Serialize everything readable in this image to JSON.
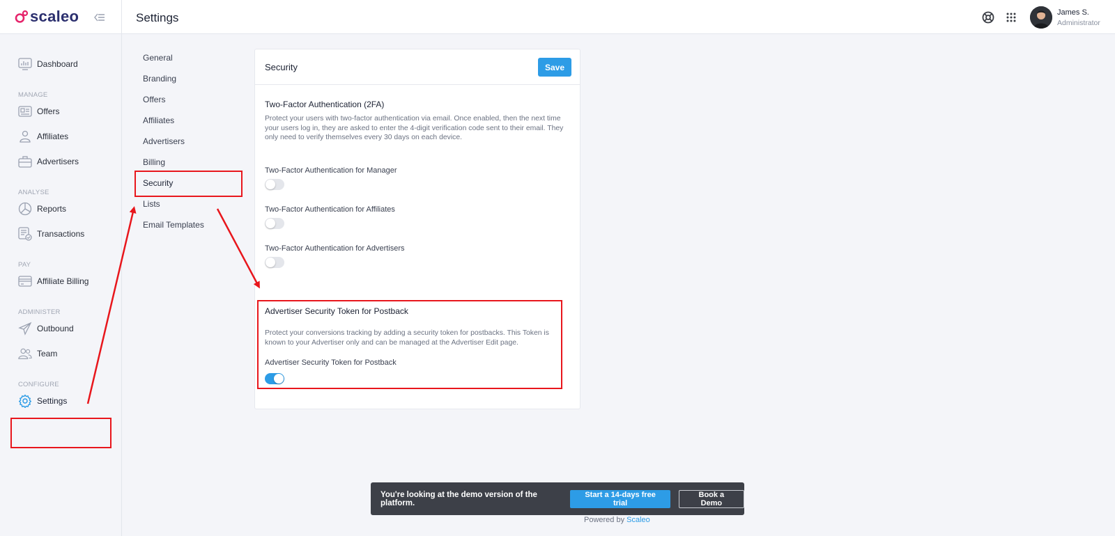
{
  "app": {
    "logo_text": "scaleo",
    "brand_color": "#e5246b",
    "accent": "#2d9ce6"
  },
  "header": {
    "title": "Settings",
    "user": {
      "name": "James S.",
      "role": "Administrator"
    }
  },
  "sidebar": {
    "items": [
      {
        "label": "Dashboard",
        "icon": "dashboard-icon"
      },
      {
        "section": "MANAGE"
      },
      {
        "label": "Offers",
        "icon": "offers-icon"
      },
      {
        "label": "Affiliates",
        "icon": "user-icon"
      },
      {
        "label": "Advertisers",
        "icon": "briefcase-icon"
      },
      {
        "section": "ANALYSE"
      },
      {
        "label": "Reports",
        "icon": "pie-chart-icon"
      },
      {
        "label": "Transactions",
        "icon": "transactions-icon"
      },
      {
        "section": "PAY"
      },
      {
        "label": "Affiliate Billing",
        "icon": "credit-card-icon"
      },
      {
        "section": "ADMINISTER"
      },
      {
        "label": "Outbound",
        "icon": "paper-plane-icon"
      },
      {
        "label": "Team",
        "icon": "team-icon"
      },
      {
        "section": "CONFIGURE"
      },
      {
        "label": "Settings",
        "icon": "gear-icon",
        "active": true
      }
    ]
  },
  "submenu": {
    "items": [
      "General",
      "Branding",
      "Offers",
      "Affiliates",
      "Advertisers",
      "Billing",
      "Security",
      "Lists",
      "Email Templates"
    ],
    "active": "Security"
  },
  "card": {
    "title": "Security",
    "save_label": "Save",
    "twofa": {
      "title": "Two-Factor Authentication (2FA)",
      "description": "Protect your users with two-factor authentication via email. Once enabled, then the next time your users log in, they are asked to enter the 4-digit verification code sent to their email. They only need to verify themselves every 30 days on each device.",
      "toggles": [
        {
          "label": "Two-Factor Authentication for Manager",
          "on": false
        },
        {
          "label": "Two-Factor Authentication for Affiliates",
          "on": false
        },
        {
          "label": "Two-Factor Authentication for Advertisers",
          "on": false
        }
      ]
    },
    "token": {
      "title": "Advertiser Security Token for Postback",
      "description": "Protect your conversions tracking by adding a security token for postbacks. This Token is known to your Advertiser only and can be managed at the Advertiser Edit page.",
      "toggle_label": "Advertiser Security Token for Postback",
      "on": true
    }
  },
  "demo_banner": {
    "text": "You're looking at the demo version of the platform.",
    "trial_label": "Start a 14-days free trial",
    "demo_label": "Book a Demo"
  },
  "footer": {
    "powered_prefix": "Powered by",
    "powered_link": "Scaleo"
  },
  "annotation_color": "#e8161c"
}
